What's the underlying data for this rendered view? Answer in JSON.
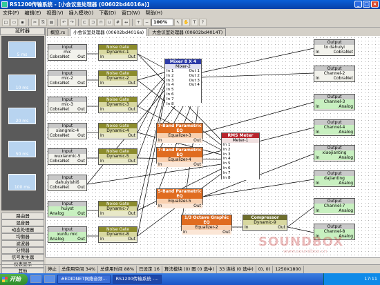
{
  "window": {
    "title": "RS1200传输系统 - [小会议室处理器 (00602bd4016a)]"
  },
  "menu": [
    "文件(F)",
    "编辑(E)",
    "视图(V)",
    "插入模块(I)",
    "下载(D)",
    "窗口(W)",
    "帮助(H)"
  ],
  "toolbar": {
    "zoom": "100%"
  },
  "tabs": [
    "概览.rs",
    "小会议室处理器 (00602bd4016a)",
    "大会议室处理器 (00602bd4014T)"
  ],
  "sidebar": {
    "header": "延时器",
    "delays": [
      "5 ms",
      "10 ms",
      "20 ms",
      "50 ms",
      "100 ms"
    ],
    "categories": [
      "路由器",
      "混音器",
      "动态处理器",
      "均衡器",
      "滤波器",
      "分频器",
      "信号发生器",
      "仪表显示",
      "其他"
    ]
  },
  "inputs": [
    {
      "title": "Input",
      "name": "mic",
      "source": "CobraNet"
    },
    {
      "title": "Input",
      "name": "mic-2",
      "source": "CobraNet"
    },
    {
      "title": "Input",
      "name": "mic-3",
      "source": "CobraNet"
    },
    {
      "title": "Input",
      "name": "xiangmic-4",
      "source": "CobraNet"
    },
    {
      "title": "Input",
      "name": "wuxianmic-5",
      "source": "CobraNet"
    },
    {
      "title": "Input",
      "name": "dahuiyishi6",
      "source": "CobraNet"
    },
    {
      "title": "Input",
      "name": "huiyst",
      "source": "Analog"
    },
    {
      "title": "Input",
      "name": "xunfu mic",
      "source": "Analog"
    }
  ],
  "gates": [
    {
      "title": "Noise Gate",
      "name": "Dynamic-1"
    },
    {
      "title": "Noise Gate",
      "name": "Dynamic-2"
    },
    {
      "title": "Noise Gate",
      "name": "Dynamic-3"
    },
    {
      "title": "Noise Gate",
      "name": "Dynamic-4"
    },
    {
      "title": "Noise Gate",
      "name": "Dynamic-5"
    },
    {
      "title": "Noise Gate",
      "name": "Dynamic-7"
    },
    {
      "title": "Noise Gate",
      "name": "Dynamic-8"
    }
  ],
  "mixer": {
    "title": "Mixer 8 X 4",
    "name": "Mixer-2",
    "ins": [
      "In 1",
      "In 2",
      "In 3",
      "In 4",
      "In 5",
      "In 6",
      "In 7",
      "In 8"
    ],
    "outs": [
      "Out 1",
      "Out 2",
      "Out 3",
      "Out 4"
    ]
  },
  "eqs": [
    {
      "title": "7-Band Parametric EQ",
      "name": "Equalizer-3"
    },
    {
      "title": "7-Band Parametric EQ",
      "name": "Equalizer-4"
    },
    {
      "title": "5-Band Parametric EQ",
      "name": "Equalizer-5"
    }
  ],
  "geq": {
    "title": "1/3 Octave Graphic EQ",
    "name": "Equalizer-2"
  },
  "rms": {
    "title": "RMS Meter",
    "name": "Meter-1",
    "ins": [
      "In 1",
      "In 2",
      "In 3",
      "In 4",
      "In 5",
      "In 6",
      "In 7",
      "In 8"
    ]
  },
  "compressor": {
    "title": "Compressor",
    "name": "Dynamic-9"
  },
  "outputs": [
    {
      "title": "Output",
      "name": "to dahuiyi",
      "dest": "CobraNet"
    },
    {
      "title": "Output",
      "name": "Channel-2",
      "dest": "CobraNet"
    },
    {
      "title": "Output",
      "name": "Channel-3",
      "dest": "Analog"
    },
    {
      "title": "Output",
      "name": "Channel-4",
      "dest": "Analog"
    },
    {
      "title": "Output",
      "name": "xiaojianting",
      "dest": "Analog"
    },
    {
      "title": "Output",
      "name": "dajianting",
      "dest": "Analog"
    },
    {
      "title": "Output",
      "name": "Channel-7",
      "dest": "Analog"
    },
    {
      "title": "Output",
      "name": "Channel-8",
      "dest": "Analog"
    }
  ],
  "labels": {
    "in": "In",
    "out": "Out"
  },
  "watermark": {
    "main": "SOUNDBOX",
    "sub": "www.soundbox.cn"
  },
  "status": [
    "停止",
    "总使用空间 34%",
    "总使用时间 88%",
    "已设定 16",
    "算法模块 (0) 图 (0 选中)",
    "33 连线 (0 选中)",
    "(0, 0)",
    "1250X1800"
  ],
  "taskbar": {
    "start": "开始",
    "tasks": [
      "#EDIDNET网络音频...",
      "RS1200传输系统 -..."
    ],
    "clock": "17:11"
  }
}
